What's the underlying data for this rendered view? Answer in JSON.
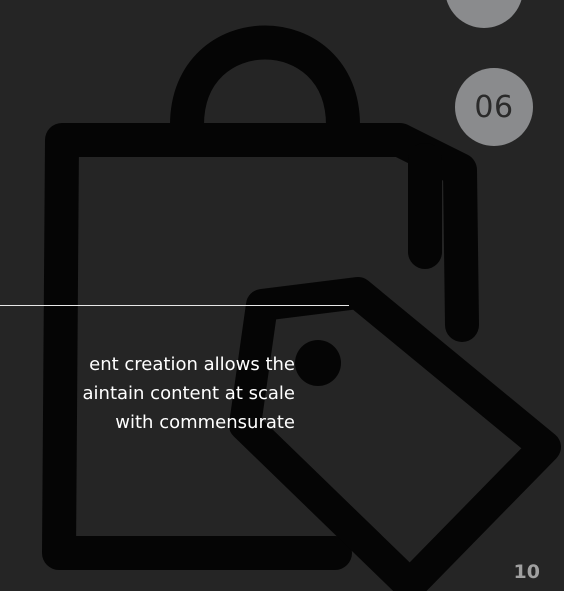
{
  "slide": {
    "step_prev": "",
    "step_current": "06",
    "page_number": "10",
    "body_lines": [
      "ent creation allows the",
      "aintain content at scale",
      "with commensurate"
    ]
  },
  "icons": {
    "background": "shopping-bag-with-price-tag-icon"
  },
  "colors": {
    "background": "#252525",
    "icon_outline": "#050505",
    "circle_fill": "#8a8b8d",
    "circle_text": "#2a2a2a",
    "divider": "#e8e8e8",
    "text": "#ffffff",
    "page_number": "#a0a0a0"
  }
}
